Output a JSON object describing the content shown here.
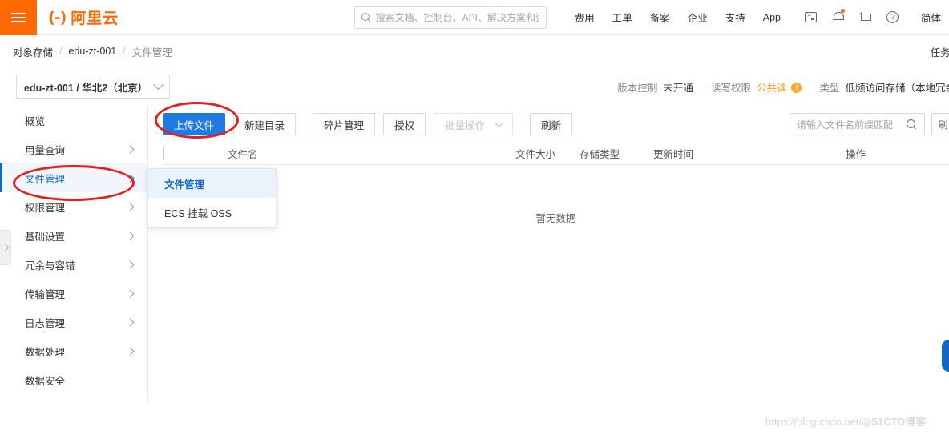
{
  "topbar": {
    "menu_icon": "hamburger-icon",
    "brand_mark": "(-)",
    "brand_text": "阿里云",
    "search": {
      "placeholder": "搜索文档、控制台、API、解决方案和资"
    },
    "nav_links": [
      "费用",
      "工单",
      "备案",
      "企业",
      "支持",
      "App"
    ],
    "icons": [
      "console-icon",
      "bell-icon",
      "cart-icon",
      "help-icon"
    ],
    "language": "简体"
  },
  "breadcrumb": {
    "items": [
      "对象存储",
      "edu-zt-001",
      "文件管理"
    ],
    "separator": "/",
    "task_list": "任务列"
  },
  "bucket_header": {
    "selector_label": "edu-zt-001 / 华北2（北京）",
    "meta": [
      {
        "key": "版本控制",
        "value": "未开通",
        "warn": false
      },
      {
        "key": "读写权限",
        "value": "公共读",
        "warn": true
      },
      {
        "key": "类型",
        "value": "低频访问存储（本地冗余",
        "warn": false
      }
    ],
    "warn_badge": "!"
  },
  "sidebar": {
    "items": [
      {
        "label": "概览",
        "has_arrow": false,
        "active": false
      },
      {
        "label": "用量查询",
        "has_arrow": true,
        "active": false
      },
      {
        "label": "文件管理",
        "has_arrow": true,
        "active": true
      },
      {
        "label": "权限管理",
        "has_arrow": true,
        "active": false
      },
      {
        "label": "基础设置",
        "has_arrow": true,
        "active": false
      },
      {
        "label": "冗余与容错",
        "has_arrow": true,
        "active": false
      },
      {
        "label": "传输管理",
        "has_arrow": true,
        "active": false
      },
      {
        "label": "日志管理",
        "has_arrow": true,
        "active": false
      },
      {
        "label": "数据处理",
        "has_arrow": true,
        "active": false
      },
      {
        "label": "数据安全",
        "has_arrow": false,
        "active": false
      }
    ]
  },
  "flyout": {
    "items": [
      {
        "label": "文件管理",
        "active": true
      },
      {
        "label": "ECS 挂载 OSS",
        "active": false
      }
    ]
  },
  "toolbar": {
    "upload_label": "上传文件",
    "newdir_label": "新建目录",
    "fragment_label": "碎片管理",
    "auth_label": "授权",
    "batch_label": "批量操作",
    "refresh_label": "刷新",
    "search_placeholder": "请输入文件名前缀匹配",
    "edge_button_label": "刷"
  },
  "table": {
    "headers": {
      "name": "文件名",
      "size": "文件大小",
      "type": "存储类型",
      "time": "更新时间",
      "ops": "操作"
    },
    "empty_text": "暂无数据",
    "rows": []
  },
  "watermark": {
    "url": "https://blog.csdn.net/",
    "handle": "@51CTO博客"
  },
  "colors": {
    "brand_orange": "#ff6a00",
    "primary_blue": "#1e7ae0",
    "active_blue": "#1266c9",
    "warn_orange": "#ffa930",
    "annotation_red": "#e32020"
  }
}
